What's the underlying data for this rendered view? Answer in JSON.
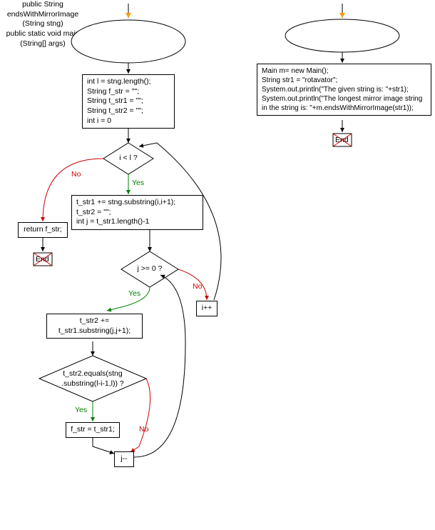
{
  "left_flow": {
    "func_sig": "public String\nendsWithMirrorImage\n(String stng)",
    "init_block": "int l = stng.length();\nString f_str = \"\";\nString t_str1 = \"\";\nString t_str2 = \"\";\nint i = 0",
    "cond_i": "i < l ?",
    "return_stmt": "return f_str;",
    "inner_block": "t_str1 += stng.substring(i,i+1);\nt_str2 = \"\";\nint j = t_str1.length()-1",
    "cond_j": "j >= 0 ?",
    "incr_i": "i++",
    "substr_block": "t_str2 +=\nt_str1.substring(j,j+1);",
    "cond_equals": "t_str2.equals(stng\n.substring(l-i-1,l)) ?",
    "assign_fstr": "f_str = t_str1;",
    "decr_j": "j--",
    "end": "End"
  },
  "right_flow": {
    "main_sig": "public static void main\n(String[] args)",
    "main_body": "Main m= new Main();\nString str1 = \"rotavator\";\nSystem.out.println(\"The given string is: \"+str1);\nSystem.out.println(\"The longest mirror image string\nin the string is: \"+m.endsWithMirrorImage(str1));",
    "end": "End"
  },
  "labels": {
    "yes": "Yes",
    "no": "No"
  }
}
